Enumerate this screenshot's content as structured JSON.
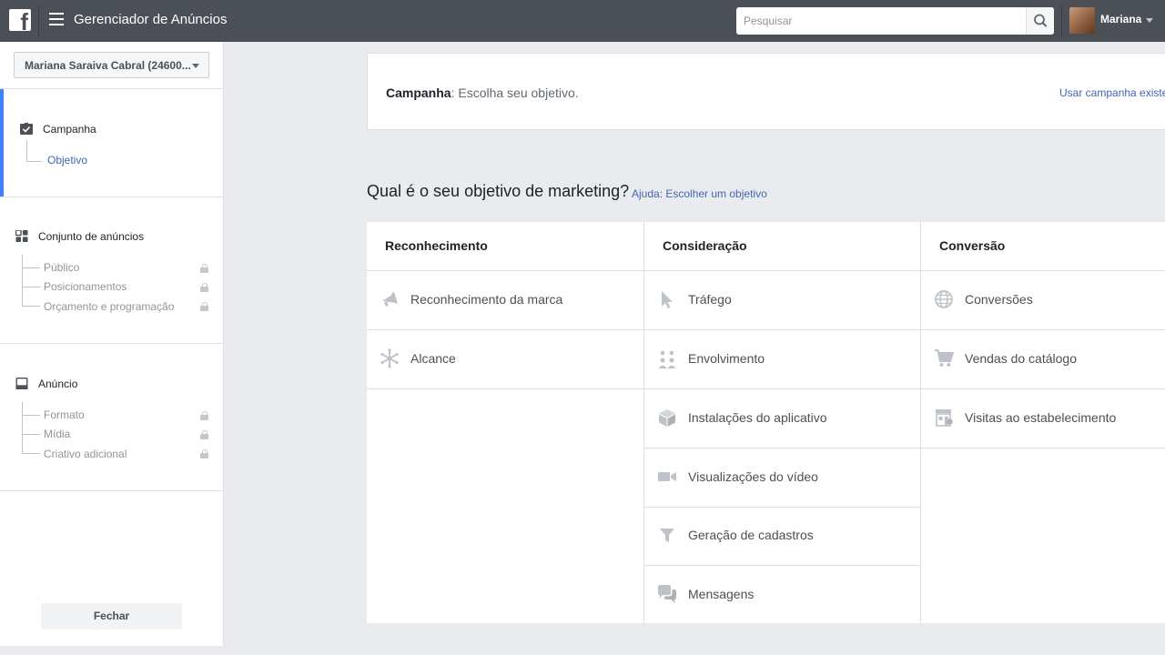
{
  "topbar": {
    "logo_icon": "facebook-f-icon",
    "menu_icon": "hamburger-icon",
    "app_title": "Gerenciador de Anúncios",
    "search_placeholder": "Pesquisar",
    "search_icon": "magnifier-icon",
    "username": "Mariana",
    "user_menu_icon": "caret-down-icon"
  },
  "sidebar": {
    "account_select": "Mariana Saraiva Cabral (24600...",
    "sections": [
      {
        "icon": "checkbox-icon",
        "title": "Campanha",
        "items": [
          {
            "label": "Objetivo",
            "active": true,
            "locked": false
          }
        ]
      },
      {
        "icon": "grid-icon",
        "title": "Conjunto de anúncios",
        "items": [
          {
            "label": "Público",
            "locked": true
          },
          {
            "label": "Posicionamentos",
            "locked": true
          },
          {
            "label": "Orçamento e programação",
            "locked": true
          }
        ]
      },
      {
        "icon": "monitor-icon",
        "title": "Anúncio",
        "items": [
          {
            "label": "Formato",
            "locked": true
          },
          {
            "label": "Mídia",
            "locked": true
          },
          {
            "label": "Criativo adicional",
            "locked": true
          }
        ]
      }
    ],
    "close_label": "Fechar"
  },
  "main": {
    "header_title_bold": "Campanha",
    "header_title_rest": ": Escolha seu objetivo.",
    "use_existing": "Usar campanha existe",
    "question": "Qual é o seu objetivo de marketing?",
    "help_link": "Ajuda: Escolher um objetivo",
    "columns": [
      {
        "title": "Reconhecimento",
        "items": [
          {
            "label": "Reconhecimento da marca",
            "icon": "megaphone-icon"
          },
          {
            "label": "Alcance",
            "icon": "asterisk-icon"
          }
        ]
      },
      {
        "title": "Consideração",
        "items": [
          {
            "label": "Tráfego",
            "icon": "cursor-icon"
          },
          {
            "label": "Envolvimento",
            "icon": "people-icon"
          },
          {
            "label": "Instalações do aplicativo",
            "icon": "box-icon"
          },
          {
            "label": "Visualizações do vídeo",
            "icon": "video-camera-icon"
          },
          {
            "label": "Geração de cadastros",
            "icon": "funnel-icon"
          },
          {
            "label": "Mensagens",
            "icon": "chat-bubbles-icon"
          }
        ]
      },
      {
        "title": "Conversão",
        "items": [
          {
            "label": "Conversões",
            "icon": "globe-icon"
          },
          {
            "label": "Vendas do catálogo",
            "icon": "shopping-cart-icon"
          },
          {
            "label": "Visitas ao estabelecimento",
            "icon": "store-icon"
          }
        ]
      }
    ]
  },
  "colors": {
    "topbar": "#4b4f56",
    "accent_blue": "#4080ff",
    "link_blue": "#4267b2",
    "icon_gray": "#bec3c9"
  }
}
